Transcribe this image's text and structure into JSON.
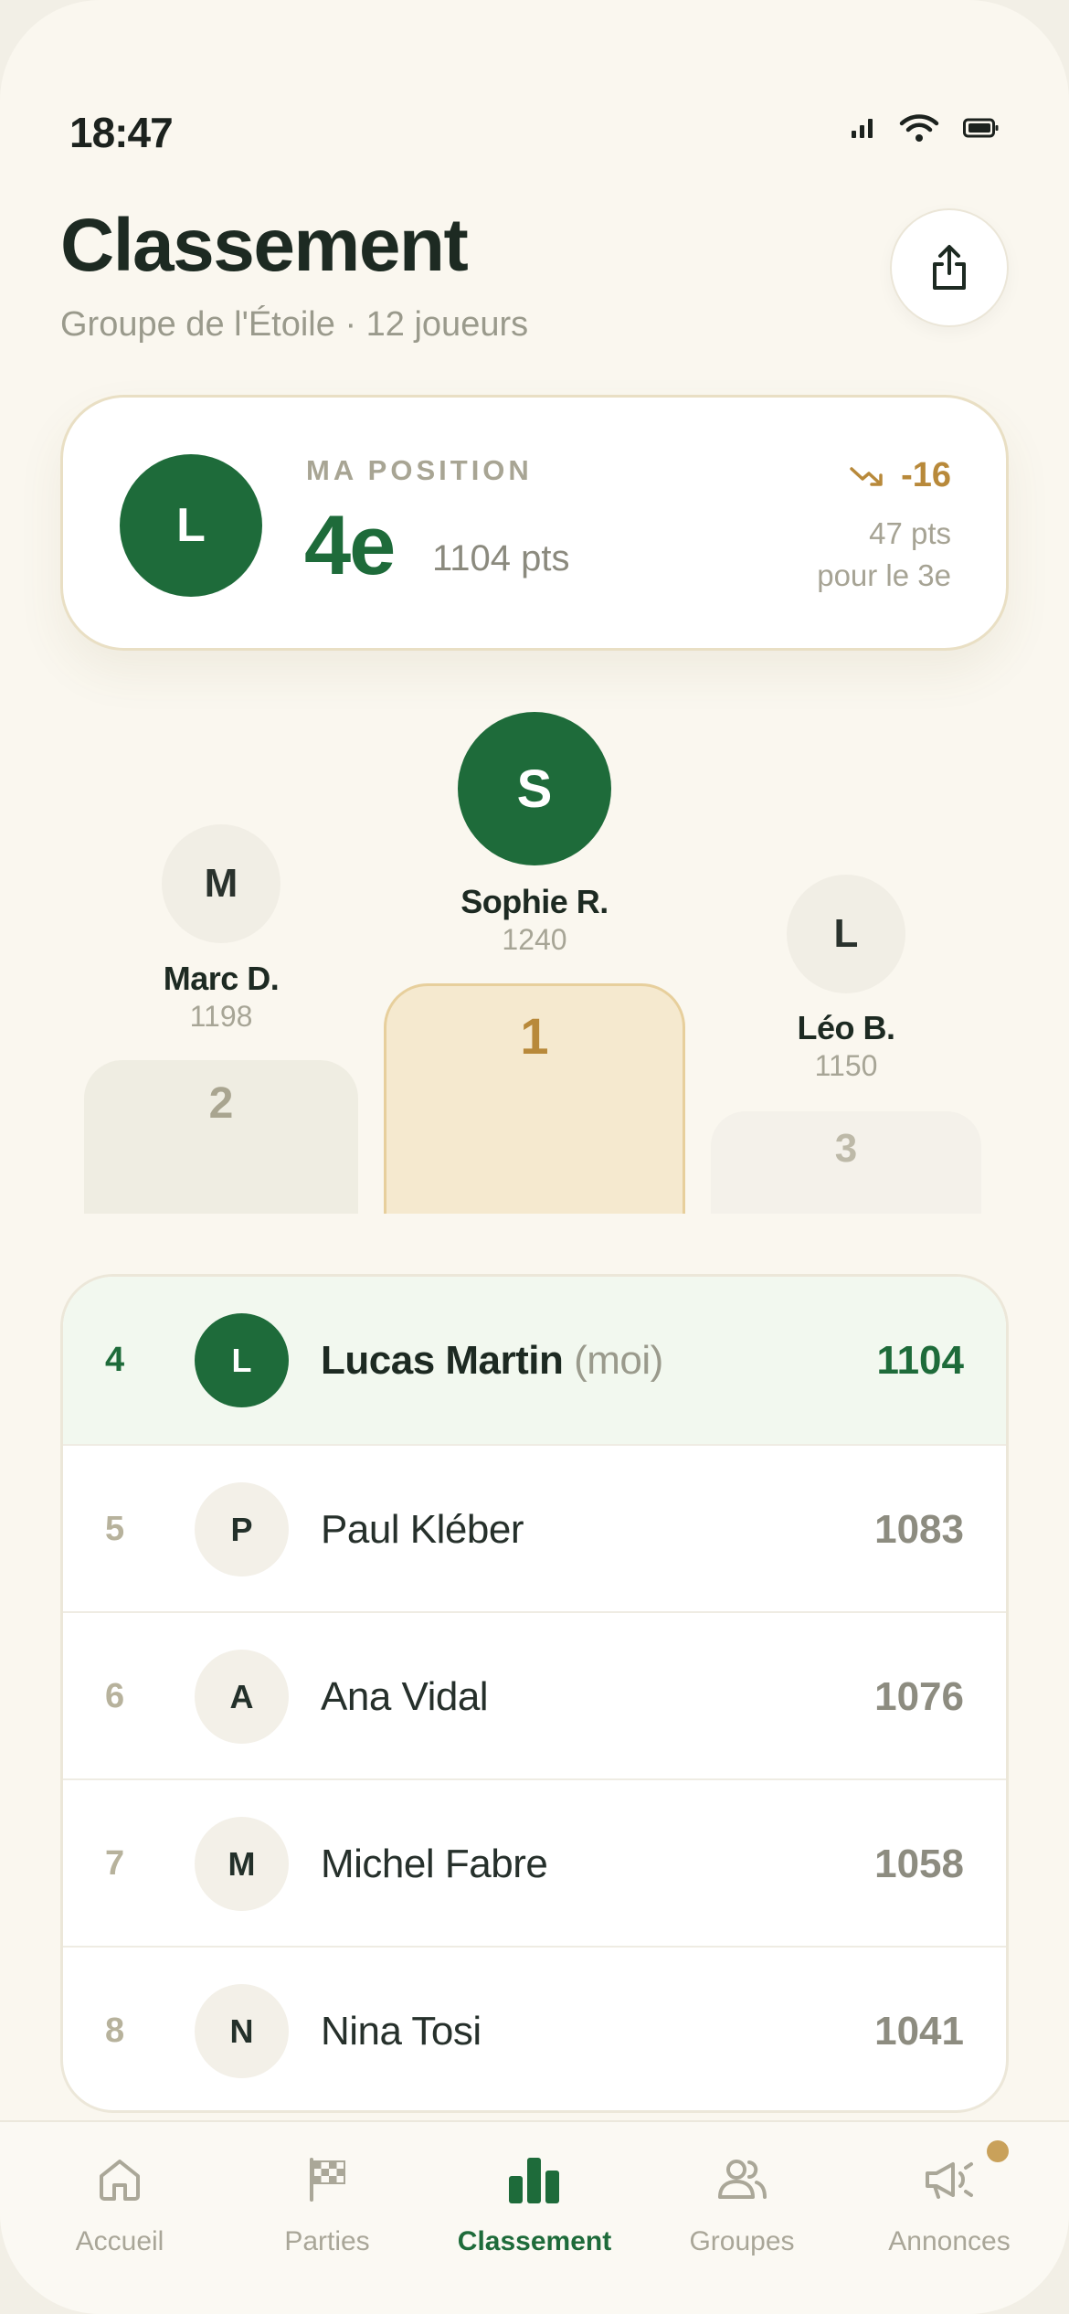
{
  "status_bar": {
    "time": "18:47"
  },
  "header": {
    "title": "Classement",
    "subtitle": "Groupe de l'Étoile · 12 joueurs"
  },
  "my_position": {
    "label": "MA POSITION",
    "avatar": "L",
    "rank": "4e",
    "points": "1104 pts",
    "trend": "-16",
    "gap_points": "47 pts",
    "gap_target": "pour le 3e"
  },
  "podium": {
    "first": {
      "initial": "S",
      "name": "Sophie R.",
      "score": "1240",
      "place": "1"
    },
    "second": {
      "initial": "M",
      "name": "Marc D.",
      "score": "1198",
      "place": "2"
    },
    "third": {
      "initial": "L",
      "name": "Léo B.",
      "score": "1150",
      "place": "3"
    }
  },
  "ranking": [
    {
      "rank": "4",
      "initial": "L",
      "name": "Lucas Martin",
      "suffix": "(moi)",
      "score": "1104"
    },
    {
      "rank": "5",
      "initial": "P",
      "name": "Paul Kléber",
      "score": "1083"
    },
    {
      "rank": "6",
      "initial": "A",
      "name": "Ana Vidal",
      "score": "1076"
    },
    {
      "rank": "7",
      "initial": "M",
      "name": "Michel Fabre",
      "score": "1058"
    },
    {
      "rank": "8",
      "initial": "N",
      "name": "Nina Tosi",
      "score": "1041"
    }
  ],
  "tabs": [
    {
      "label": "Accueil",
      "icon": "home-icon"
    },
    {
      "label": "Parties",
      "icon": "checkered-flag-icon"
    },
    {
      "label": "Classement",
      "icon": "bar-chart-icon",
      "active": true
    },
    {
      "label": "Groupes",
      "icon": "users-icon"
    },
    {
      "label": "Annonces",
      "icon": "megaphone-icon"
    }
  ],
  "colors": {
    "accent": "#1e6b3a",
    "gold": "#b8893a",
    "background": "#faf7ef"
  }
}
